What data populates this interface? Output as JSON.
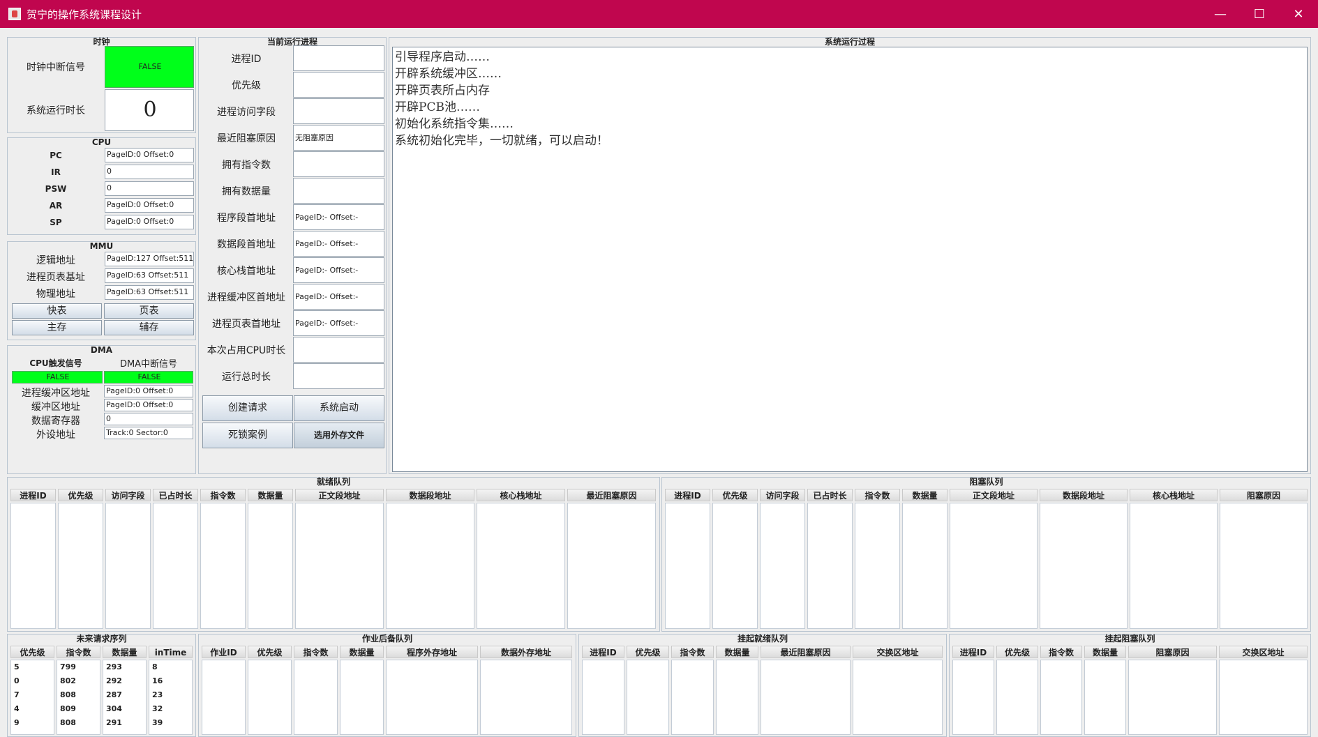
{
  "window": {
    "title": "贺宁的操作系统课程设计",
    "min": "—",
    "max": "☐",
    "close": "✕"
  },
  "clock": {
    "title": "时钟",
    "irq_label": "时钟中断信号",
    "irq_value": "FALSE",
    "runtime_label": "系统运行时长",
    "runtime_value": "0"
  },
  "cpu": {
    "title": "CPU",
    "rows": [
      {
        "label": "PC",
        "value": "PageID:0 Offset:0"
      },
      {
        "label": "IR",
        "value": "0"
      },
      {
        "label": "PSW",
        "value": "0"
      },
      {
        "label": "AR",
        "value": "PageID:0 Offset:0"
      },
      {
        "label": "SP",
        "value": "PageID:0 Offset:0"
      }
    ]
  },
  "mmu": {
    "title": "MMU",
    "rows": [
      {
        "label": "逻辑地址",
        "value": "PageID:127 Offset:511"
      },
      {
        "label": "进程页表基址",
        "value": "PageID:63 Offset:511"
      },
      {
        "label": "物理地址",
        "value": "PageID:63 Offset:511"
      }
    ],
    "buttons": [
      "快表",
      "页表",
      "主存",
      "辅存"
    ]
  },
  "dma": {
    "title": "DMA",
    "cpu_sig_label": "CPU触发信号",
    "dma_irq_label": "DMA中断信号",
    "cpu_sig_value": "FALSE",
    "dma_irq_value": "FALSE",
    "rows": [
      {
        "label": "进程缓冲区地址",
        "value": "PageID:0 Offset:0"
      },
      {
        "label": "缓冲区地址",
        "value": "PageID:0 Offset:0"
      },
      {
        "label": "数据寄存器",
        "value": "0"
      },
      {
        "label": "外设地址",
        "value": "Track:0  Sector:0"
      }
    ]
  },
  "current": {
    "title": "当前运行进程",
    "rows": [
      {
        "label": "进程ID",
        "value": ""
      },
      {
        "label": "优先级",
        "value": ""
      },
      {
        "label": "进程访问字段",
        "value": ""
      },
      {
        "label": "最近阻塞原因",
        "value": "无阻塞原因"
      },
      {
        "label": "拥有指令数",
        "value": ""
      },
      {
        "label": "拥有数据量",
        "value": ""
      },
      {
        "label": "程序段首地址",
        "value": "PageID:- Offset:-"
      },
      {
        "label": "数据段首地址",
        "value": "PageID:- Offset:-"
      },
      {
        "label": "核心栈首地址",
        "value": "PageID:- Offset:-"
      },
      {
        "label": "进程缓冲区首地址",
        "value": "PageID:- Offset:-"
      },
      {
        "label": "进程页表首地址",
        "value": "PageID:- Offset:-"
      },
      {
        "label": "本次占用CPU时长",
        "value": ""
      },
      {
        "label": "运行总时长",
        "value": ""
      }
    ],
    "buttons": [
      "创建请求",
      "系统启动",
      "死锁案例",
      "选用外存文件"
    ]
  },
  "log": {
    "title": "系统运行过程",
    "lines": [
      "引导程序启动……",
      "开辟系统缓冲区……",
      "开辟页表所占内存",
      "开辟PCB池……",
      "初始化系统指令集……",
      "系统初始化完毕，一切就绪，可以启动！"
    ]
  },
  "ready": {
    "title": "就绪队列",
    "cols": [
      "进程ID",
      "优先级",
      "访问字段",
      "已占时长",
      "指令数",
      "数据量",
      "正文段地址",
      "数据段地址",
      "核心栈地址",
      "最近阻塞原因"
    ]
  },
  "blocked": {
    "title": "阻塞队列",
    "cols": [
      "进程ID",
      "优先级",
      "访问字段",
      "已占时长",
      "指令数",
      "数据量",
      "正文段地址",
      "数据段地址",
      "核心栈地址",
      "阻塞原因"
    ]
  },
  "future": {
    "title": "未来请求序列",
    "cols": [
      "优先级",
      "指令数",
      "数据量",
      "inTime"
    ],
    "rows": [
      [
        "5",
        "799",
        "293",
        "8"
      ],
      [
        "0",
        "802",
        "292",
        "16"
      ],
      [
        "7",
        "808",
        "287",
        "23"
      ],
      [
        "4",
        "809",
        "304",
        "32"
      ],
      [
        "9",
        "808",
        "291",
        "39"
      ]
    ]
  },
  "backup": {
    "title": "作业后备队列",
    "cols": [
      "作业ID",
      "优先级",
      "指令数",
      "数据量",
      "程序外存地址",
      "数据外存地址"
    ]
  },
  "suspend_ready": {
    "title": "挂起就绪队列",
    "cols": [
      "进程ID",
      "优先级",
      "指令数",
      "数据量",
      "最近阻塞原因",
      "交换区地址"
    ]
  },
  "suspend_blocked": {
    "title": "挂起阻塞队列",
    "cols": [
      "进程ID",
      "优先级",
      "指令数",
      "数据量",
      "阻塞原因",
      "交换区地址"
    ]
  }
}
